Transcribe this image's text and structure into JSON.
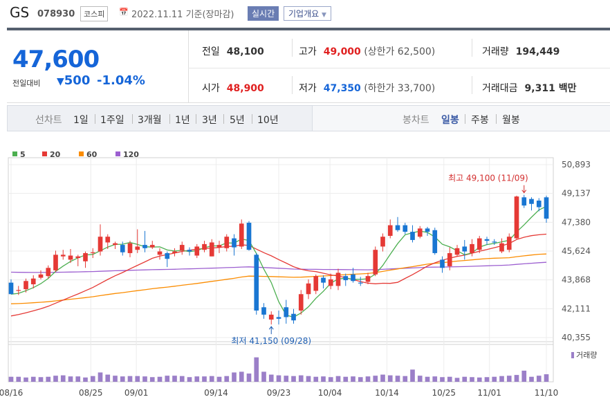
{
  "header": {
    "name": "GS",
    "code": "078930",
    "market": "코스피",
    "date_text": "2022.11.11 기준(장마감)",
    "realtime_label": "실시간",
    "company_label": "기업개요",
    "calendar_icon": "calendar-icon"
  },
  "price": {
    "current": "47,600",
    "change_label": "전일대비",
    "change_value": "500",
    "change_pct": "-1.04%",
    "direction_icon": "down-triangle-icon"
  },
  "stats": {
    "prev_close_label": "전일",
    "prev_close": "48,100",
    "open_label": "시가",
    "open": "48,900",
    "high_label": "고가",
    "high": "49,000",
    "upper_limit": "(상한가 62,500)",
    "low_label": "저가",
    "low": "47,350",
    "lower_limit": "(하한가 33,700)",
    "volume_label": "거래량",
    "volume": "194,449",
    "amount_label": "거래대금",
    "amount": "9,311 백만"
  },
  "period_tabs": {
    "line_chart_label": "선차트",
    "line_items": [
      "1일",
      "1주일",
      "3개월",
      "1년",
      "3년",
      "5년",
      "10년"
    ],
    "candle_chart_label": "봉차트",
    "candle_items": [
      "일봉",
      "주봉",
      "월봉"
    ],
    "candle_active": "일봉"
  },
  "colors": {
    "up": "#e53935",
    "down": "#1976d2",
    "ma5": "#4caf50",
    "ma20": "#e53935",
    "ma60": "#fb8c00",
    "ma120": "#9c5fd0",
    "volume": "#9b7fc8"
  },
  "chart_data": {
    "type": "candlestick",
    "y_ticks": [
      "50,893",
      "49,137",
      "47,380",
      "45,624",
      "43,868",
      "42,111",
      "40,355"
    ],
    "ylim": [
      40355,
      50893
    ],
    "x_ticks": [
      "08/16",
      "08/25",
      "09/01",
      "09/14",
      "09/23",
      "10/04",
      "10/14",
      "10/25",
      "11/01",
      "11/10"
    ],
    "legend": [
      "5",
      "20",
      "60",
      "120"
    ],
    "volume_label": "거래량",
    "high_annotation": "최고 49,100 (11/09)",
    "low_annotation": "최저 41,150 (09/28)",
    "candles": [
      [
        43700,
        43000,
        43900,
        43000
      ],
      [
        43250,
        43250,
        43500,
        42950
      ],
      [
        43300,
        43800,
        43950,
        43100
      ],
      [
        43600,
        43950,
        44150,
        43350
      ],
      [
        44000,
        44200,
        44450,
        43900
      ],
      [
        44100,
        44600,
        44750,
        43950
      ],
      [
        44450,
        45400,
        45650,
        44350
      ],
      [
        45300,
        45400,
        45700,
        45100
      ],
      [
        45100,
        45350,
        45750,
        44900
      ],
      [
        45200,
        45300,
        45400,
        44700
      ],
      [
        45000,
        45500,
        45600,
        44600
      ],
      [
        45500,
        45550,
        45800,
        45200
      ],
      [
        45600,
        46500,
        47250,
        45350
      ],
      [
        46150,
        46500,
        46650,
        45750
      ],
      [
        46000,
        46100,
        46200,
        45750
      ],
      [
        46000,
        45550,
        46200,
        45350
      ],
      [
        45500,
        46100,
        46250,
        45250
      ],
      [
        45700,
        45900,
        46950,
        45500
      ],
      [
        46000,
        45800,
        46850,
        45550
      ],
      [
        45850,
        46000,
        46250,
        45750
      ],
      [
        45400,
        45600,
        45800,
        45100
      ],
      [
        45500,
        45150,
        45600,
        44650
      ],
      [
        45500,
        45600,
        45800,
        45300
      ],
      [
        45650,
        46000,
        46200,
        45400
      ],
      [
        45700,
        45600,
        45850,
        45350
      ],
      [
        45350,
        45900,
        46050,
        45200
      ],
      [
        45700,
        46050,
        46250,
        45550
      ],
      [
        45300,
        46150,
        46350,
        45300
      ],
      [
        45850,
        46000,
        46250,
        45500
      ],
      [
        45800,
        46500,
        46650,
        45600
      ],
      [
        46400,
        45850,
        46650,
        45350
      ],
      [
        45900,
        47300,
        47550,
        45750
      ],
      [
        47350,
        45700,
        47450,
        45650
      ],
      [
        45400,
        42000,
        45500,
        41750
      ],
      [
        42200,
        41750,
        42450,
        41500
      ],
      [
        41450,
        41750,
        41950,
        41150
      ],
      [
        41600,
        41500,
        42000,
        41150
      ],
      [
        42200,
        41600,
        42650,
        41200
      ],
      [
        41800,
        41400,
        42100,
        41200
      ],
      [
        42000,
        43000,
        43250,
        41750
      ],
      [
        43000,
        43650,
        43900,
        42700
      ],
      [
        43200,
        44100,
        44200,
        43000
      ],
      [
        44000,
        43700,
        44150,
        43350
      ],
      [
        43500,
        43900,
        44250,
        43300
      ],
      [
        43500,
        44300,
        44550,
        43250
      ],
      [
        44100,
        43850,
        44250,
        43500
      ],
      [
        44200,
        43800,
        44600,
        43700
      ],
      [
        43700,
        43650,
        44050,
        43500
      ],
      [
        43750,
        44100,
        44300,
        43600
      ],
      [
        44200,
        45700,
        45900,
        44100
      ],
      [
        45900,
        46500,
        46700,
        45600
      ],
      [
        46550,
        47200,
        47550,
        46400
      ],
      [
        47200,
        46900,
        47700,
        46800
      ],
      [
        47200,
        46800,
        47350,
        46650
      ],
      [
        46800,
        46300,
        47200,
        46150
      ],
      [
        46500,
        47000,
        47150,
        46400
      ],
      [
        47000,
        46800,
        47100,
        46550
      ],
      [
        46900,
        45500,
        47050,
        45400
      ],
      [
        45100,
        44600,
        45300,
        44300
      ],
      [
        44700,
        45500,
        45850,
        44450
      ],
      [
        45400,
        45800,
        46000,
        45300
      ],
      [
        45900,
        45600,
        46300,
        45100
      ],
      [
        45500,
        46050,
        46350,
        45300
      ],
      [
        45700,
        46400,
        46550,
        45500
      ],
      [
        46350,
        46250,
        46500,
        46000
      ],
      [
        46200,
        46150,
        46350,
        46000
      ],
      [
        45600,
        46100,
        46400,
        45500
      ],
      [
        45700,
        46500,
        46700,
        45550
      ],
      [
        46400,
        48950,
        49000,
        46350
      ],
      [
        48900,
        48400,
        49050,
        48250
      ],
      [
        48800,
        48500,
        48900,
        48100
      ],
      [
        48700,
        48300,
        48850,
        48050
      ],
      [
        48900,
        47600,
        49000,
        47350
      ]
    ],
    "volumes": [
      0.14,
      0.14,
      0.12,
      0.14,
      0.13,
      0.14,
      0.17,
      0.18,
      0.15,
      0.15,
      0.12,
      0.16,
      0.26,
      0.2,
      0.17,
      0.15,
      0.16,
      0.16,
      0.15,
      0.13,
      0.14,
      0.17,
      0.17,
      0.16,
      0.13,
      0.15,
      0.15,
      0.16,
      0.14,
      0.16,
      0.26,
      0.28,
      0.23,
      0.68,
      0.28,
      0.2,
      0.18,
      0.17,
      0.16,
      0.18,
      0.16,
      0.14,
      0.15,
      0.13,
      0.16,
      0.14,
      0.15,
      0.13,
      0.15,
      0.17,
      0.2,
      0.18,
      0.17,
      0.16,
      0.34,
      0.17,
      0.14,
      0.15,
      0.13,
      0.14,
      0.11,
      0.14,
      0.13,
      0.12,
      0.13,
      0.14,
      0.16,
      0.17,
      0.19,
      0.31,
      0.14,
      0.17,
      0.21
    ]
  }
}
